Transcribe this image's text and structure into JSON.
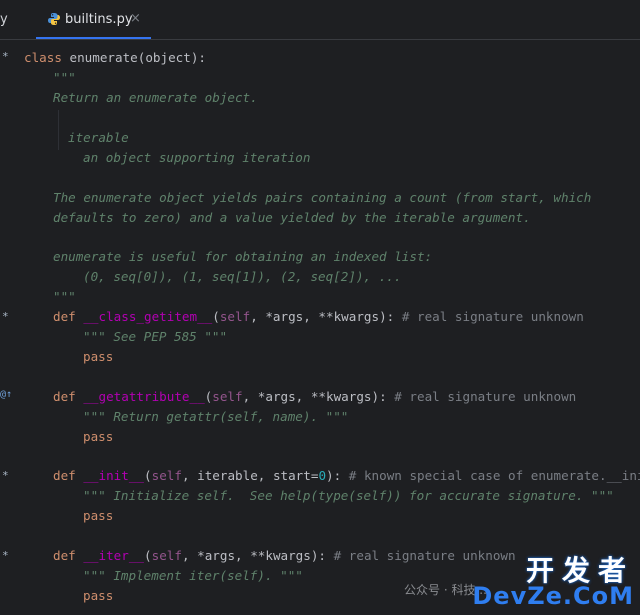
{
  "tabs": {
    "previous_label": "y",
    "active_label": "builtins.py",
    "close_glyph": "×"
  },
  "code": {
    "l1": {
      "kw": "class",
      "name": " enumerate(object):"
    },
    "l2": {
      "text": "\"\"\""
    },
    "l3": {
      "text": "Return an enumerate object."
    },
    "l4": {
      "text": "iterable"
    },
    "l5": {
      "text": "an object supporting iteration"
    },
    "l6": {
      "text": "The enumerate object yields pairs containing a count (from start, which"
    },
    "l7": {
      "text": "defaults to zero) and a value yielded by the iterable argument."
    },
    "l8": {
      "text": "enumerate is useful for obtaining an indexed list:"
    },
    "l9": {
      "text": "(0, seq[0]), (1, seq[1]), (2, seq[2]), ..."
    },
    "l10": {
      "text": "\"\"\""
    },
    "l11": {
      "kw": "def",
      "name": "__class_getitem__",
      "open": "(",
      "self": "self",
      "args": ", *args, **kwargs): ",
      "comment": "# real signature unknown"
    },
    "l12": {
      "text": "\"\"\" See PEP 585 \"\"\""
    },
    "l13": {
      "kw": "pass"
    },
    "l14": {
      "kw": "def",
      "name": "__getattribute__",
      "open": "(",
      "self": "self",
      "args": ", *args, **kwargs): ",
      "comment": "# real signature unknown"
    },
    "l15": {
      "text": "\"\"\" Return getattr(self, name). \"\"\""
    },
    "l16": {
      "kw": "pass"
    },
    "l17": {
      "kw": "def",
      "name": "__init__",
      "open": "(",
      "self": "self",
      "args": ", iterable, start=",
      "num": "0",
      "close": "): ",
      "comment": "# known special case of enumerate.__init__"
    },
    "l18": {
      "text": "\"\"\" Initialize self.  See help(type(self)) for accurate signature. \"\"\""
    },
    "l19": {
      "kw": "pass"
    },
    "l20": {
      "kw": "def",
      "name": "__iter__",
      "open": "(",
      "self": "self",
      "args": ", *args, **kwargs): ",
      "comment": "# real signature unknown"
    },
    "l21": {
      "text": "\"\"\" Implement iter(self). \"\"\""
    },
    "l22": {
      "kw": "pass"
    }
  },
  "gutter": {
    "mark_star": "*",
    "mark_override": "@↑"
  },
  "watermark": {
    "brand": "开发者",
    "site": "DevZe.CoM",
    "social": "公众号 · 科技..."
  },
  "colors": {
    "background": "#1e1f22",
    "keyword": "#cf8e6d",
    "docstring": "#5f826b",
    "dunder": "#b200b2",
    "self": "#94558d",
    "number": "#2aacb8",
    "comment": "#7a7e85",
    "tab_accent": "#3574f0"
  }
}
